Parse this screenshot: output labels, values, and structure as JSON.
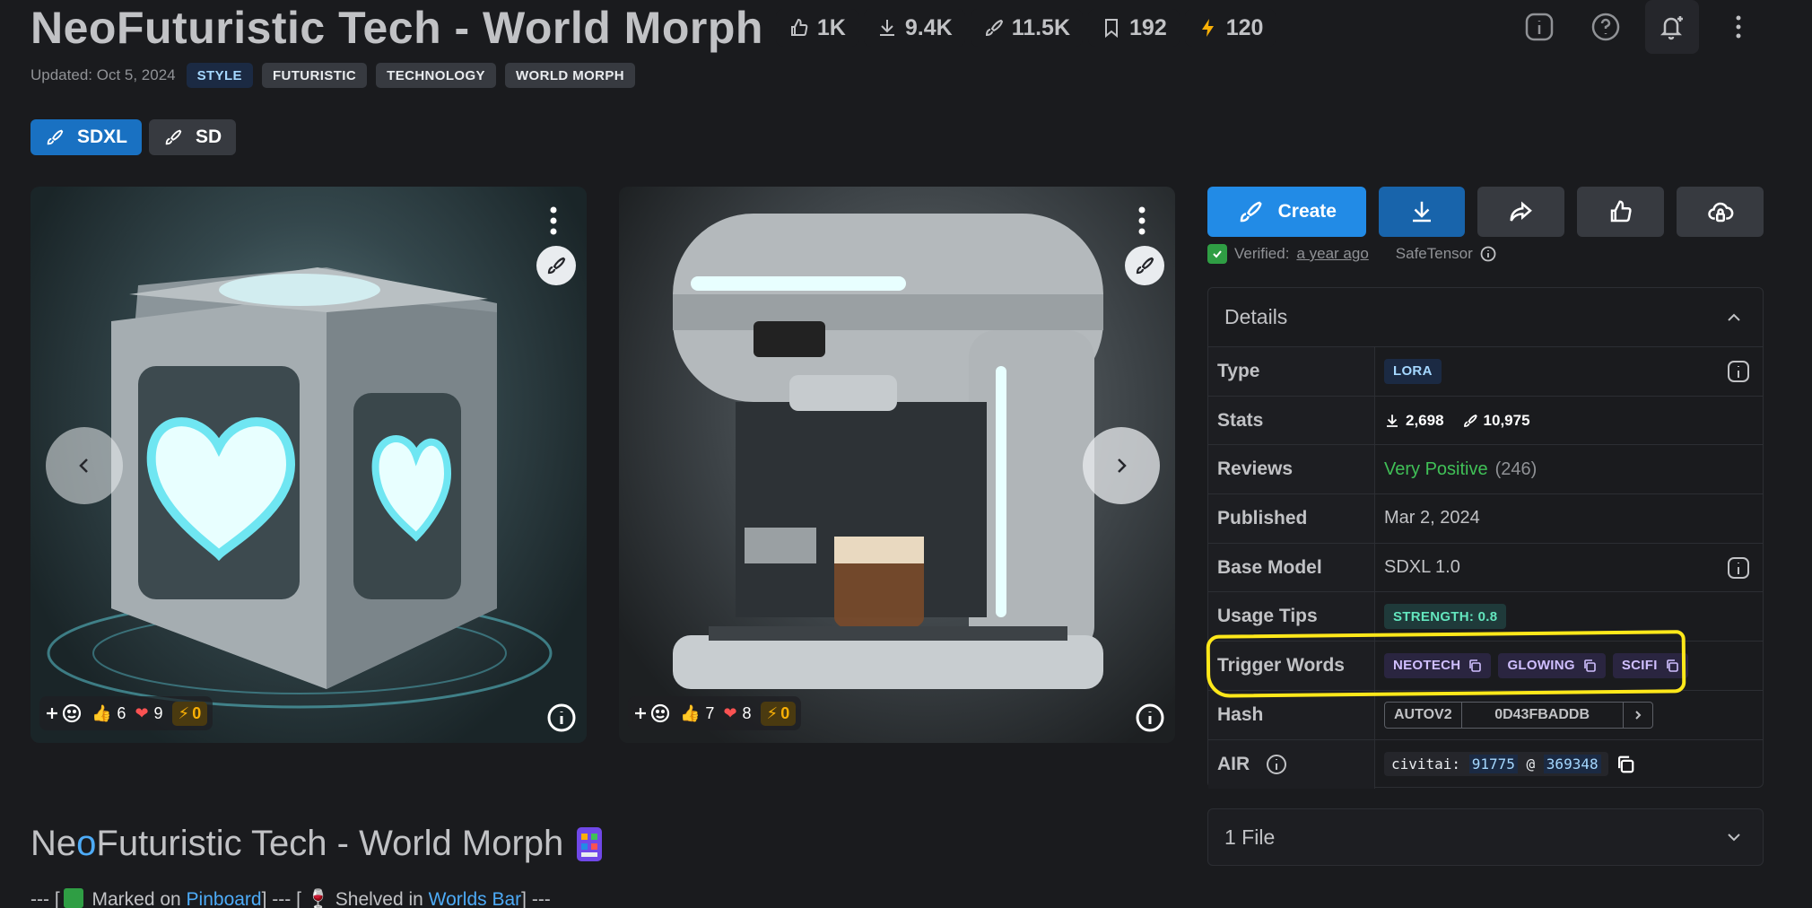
{
  "model": {
    "title": "NeoFuturistic Tech - World Morph",
    "stats": {
      "likes": "1K",
      "downloads": "9.4K",
      "generations": "11.5K",
      "bookmarks": "192",
      "buzz": "120"
    },
    "updated": "Updated: Oct 5, 2024",
    "tags": [
      "STYLE",
      "FUTURISTIC",
      "TECHNOLOGY",
      "WORLD MORPH"
    ],
    "base_chips": [
      "SDXL",
      "SD"
    ]
  },
  "cards": [
    {
      "likes": "6",
      "hearts": "9",
      "buzz": "0"
    },
    {
      "likes": "7",
      "hearts": "8",
      "buzz": "0"
    }
  ],
  "actions": {
    "create_label": "Create"
  },
  "verified": {
    "label": "Verified:",
    "when": "a year ago",
    "format": "SafeTensor"
  },
  "details": {
    "heading": "Details",
    "rows": {
      "type": {
        "label": "Type",
        "value": "LORA"
      },
      "stats": {
        "label": "Stats",
        "downloads": "2,698",
        "generations": "10,975"
      },
      "reviews": {
        "label": "Reviews",
        "value": "Very Positive",
        "count": "(246)"
      },
      "published": {
        "label": "Published",
        "value": "Mar 2, 2024"
      },
      "base_model": {
        "label": "Base Model",
        "value": "SDXL 1.0"
      },
      "usage_tips": {
        "label": "Usage Tips",
        "value": "STRENGTH: 0.8"
      },
      "trigger_words": {
        "label": "Trigger Words",
        "words": [
          "NEOTECH",
          "GLOWING",
          "SCIFI"
        ]
      },
      "hash": {
        "label": "Hash",
        "type": "AUTOV2",
        "value": "0D43FBADDB"
      },
      "air": {
        "label": "AIR",
        "prefix": "civitai:",
        "model_id": "91775",
        "at": "@",
        "version_id": "369348"
      }
    }
  },
  "files": {
    "label": "1 File"
  },
  "description": {
    "title_pre": "Ne",
    "title_o": "o",
    "title_post": "Futuristic Tech - World Morph",
    "line_start": "--- [",
    "marked": " Marked on ",
    "pinboard": "Pinboard",
    "mid": "] --- [",
    "shelved": " Shelved in ",
    "worlds_bar": "Worlds Bar",
    "end": "] ---"
  },
  "colors": {
    "accent": "#228be6",
    "highlight": "#ffe81a",
    "positive": "#40c057",
    "background": "#1a1b1e"
  }
}
